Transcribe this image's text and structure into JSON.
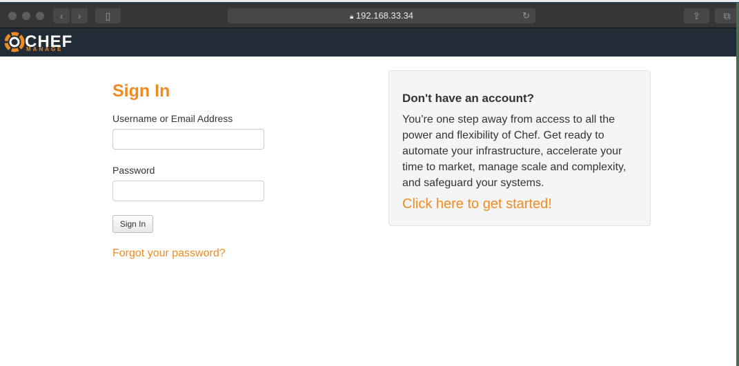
{
  "browser": {
    "url": "192.168.33.34",
    "icons": [
      "back-icon",
      "forward-icon",
      "sidebar-icon",
      "lock-icon",
      "reload-icon",
      "share-icon",
      "tabs-icon"
    ]
  },
  "brand": {
    "name": "CHEF",
    "sub": "MANAGE",
    "accent": "#f18b21",
    "nav_bg": "#222c36"
  },
  "signin": {
    "title": "Sign In",
    "username_label": "Username or Email Address",
    "username_value": "",
    "password_label": "Password",
    "password_value": "",
    "button": "Sign In",
    "forgot": "Forgot your password?"
  },
  "panel": {
    "title": "Don't have an account?",
    "body": "You’re one step away from access to all the power and flexibility of Chef. Get ready to automate your infrastructure, accelerate your time to market, manage scale and complexity, and safeguard your systems.",
    "link": "Click here to get started!"
  }
}
